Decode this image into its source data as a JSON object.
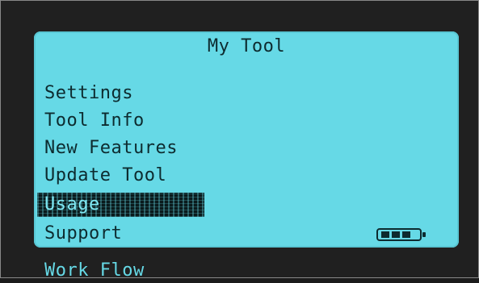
{
  "screen": {
    "title": "My Tool"
  },
  "menu": {
    "items": [
      {
        "label": "Settings"
      },
      {
        "label": "Tool Info"
      },
      {
        "label": "New Features"
      },
      {
        "label": "Update Tool"
      },
      {
        "label": "Usage",
        "selected": true
      },
      {
        "label": "Support"
      }
    ],
    "next_item": "Work Flow"
  },
  "status": {
    "battery_level": 1.0,
    "battery_icon": "battery-icon"
  },
  "colors": {
    "lcd_background": "#66d9e6",
    "text": "#0d2b2f",
    "bezel": "#202020"
  }
}
